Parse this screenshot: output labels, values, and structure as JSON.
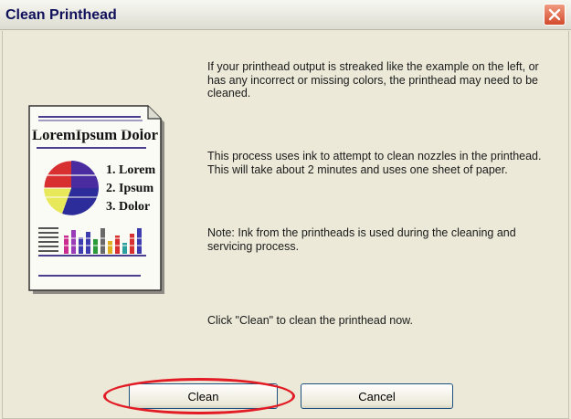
{
  "window": {
    "title": "Clean Printhead"
  },
  "illustration": {
    "heading": "LoremIpsum Dolor",
    "list": [
      "1. Lorem",
      "2. Ipsum",
      "3. Dolor"
    ]
  },
  "body": {
    "paragraph1": "If your printhead output is streaked like the example on the left, or has any incorrect or missing colors, the printhead may need to be cleaned.",
    "paragraph2": "This process uses ink to attempt to clean nozzles in the printhead. This will take about 2 minutes and uses one sheet of paper.",
    "paragraph3": "Note: Ink from the printheads is used during the cleaning and servicing process.",
    "paragraph4": "Click \"Clean\" to clean the printhead now."
  },
  "buttons": {
    "clean_label": "Clean",
    "cancel_label": "Cancel"
  },
  "colors": {
    "highlight": "#e21b25",
    "title_text": "#10105a",
    "close_button": "#d34a2c"
  }
}
